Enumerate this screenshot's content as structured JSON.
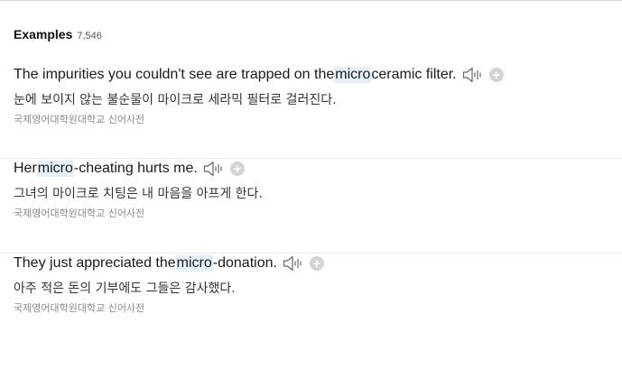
{
  "examples_section": {
    "title": "Examples",
    "count": "7,546",
    "icons": {
      "audio": "speaker-icon",
      "add": "plus-icon"
    },
    "highlight_color": "#e6f0fb",
    "items": [
      {
        "en_before": "The impurities you couldn't see are trapped on the ",
        "en_highlight": "micro",
        "en_after": " ceramic filter.",
        "ko": "눈에 보이지 않는 불순물이 마이크로 세라믹 필터로 걸러진다.",
        "source": "국제영어대학원대학교 신어사전"
      },
      {
        "en_before": "Her ",
        "en_highlight": "micro",
        "en_after": "-cheating hurts me.",
        "ko": "그녀의 마이크로 치팅은 내 마음을 아프게 한다.",
        "source": "국제영어대학원대학교 신어사전"
      },
      {
        "en_before": "They just appreciated the ",
        "en_highlight": "micro",
        "en_after": "-donation.",
        "ko": "아주 적은 돈의 기부에도 그들은 감사했다.",
        "source": "국제영어대학원대학교 신어사전"
      }
    ]
  }
}
